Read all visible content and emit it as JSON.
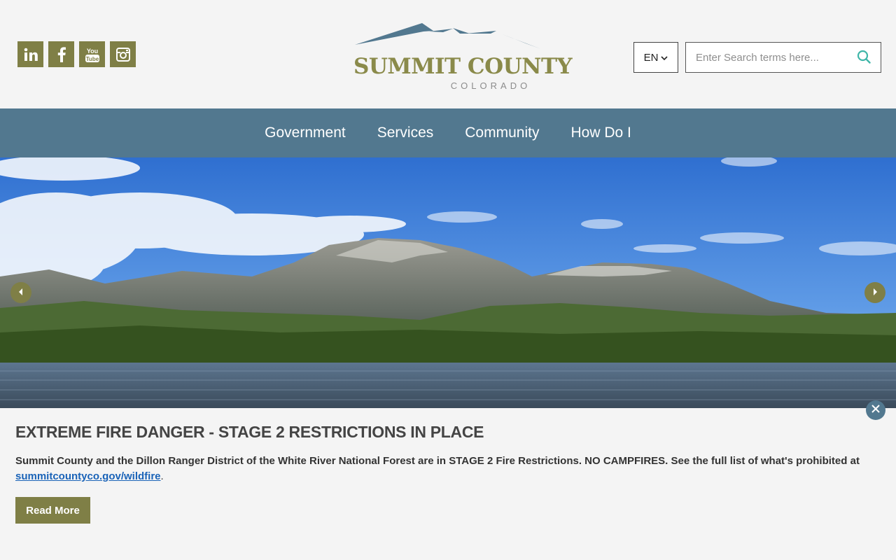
{
  "header": {
    "social": [
      {
        "name": "linkedin-icon",
        "label": "in"
      },
      {
        "name": "facebook-icon",
        "label": "f"
      },
      {
        "name": "youtube-icon",
        "label": "You Tube"
      },
      {
        "name": "instagram-icon",
        "label": ""
      }
    ],
    "logo": {
      "name": "SUMMIT COUNTY",
      "sub": "COLORADO"
    },
    "language": {
      "value": "EN"
    },
    "search": {
      "placeholder": "Enter Search terms here..."
    }
  },
  "nav": {
    "items": [
      "Government",
      "Services",
      "Community",
      "How Do I"
    ]
  },
  "alert": {
    "title": "EXTREME FIRE DANGER - STAGE 2 RESTRICTIONS IN PLACE",
    "body_text": "Summit County and the Dillon Ranger District of the White River National Forest are in STAGE 2 Fire Restrictions. NO CAMPFIRES. See the full list of what's prohibited at",
    "link_text": "summitcountyco.gov/wildfire",
    "period": ".",
    "button_label": "Read More"
  },
  "colors": {
    "accent_olive": "#7f7f46",
    "nav_blue": "#52788f",
    "background": "#f4f4f4",
    "link": "#1a63b8"
  }
}
